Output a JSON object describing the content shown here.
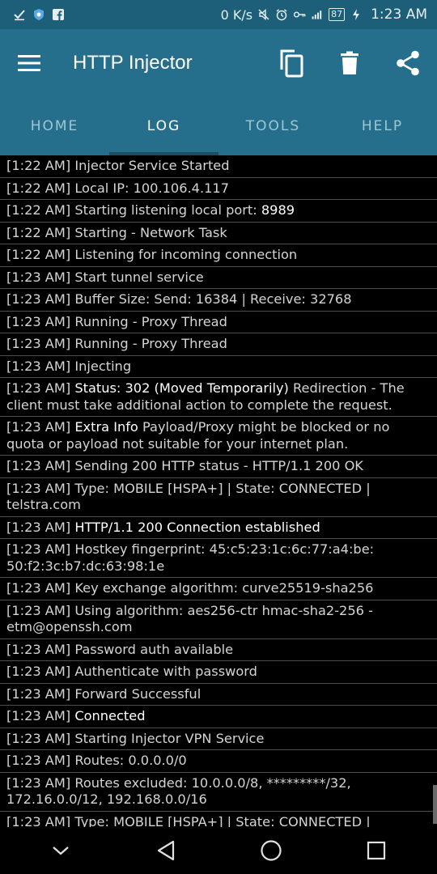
{
  "status_bar": {
    "speed": "0 K/s",
    "battery": "87",
    "time": "1:23 AM"
  },
  "app_bar": {
    "title": "HTTP Injector"
  },
  "tabs": [
    {
      "label": "HOME"
    },
    {
      "label": "LOG"
    },
    {
      "label": "TOOLS"
    },
    {
      "label": "HELP"
    }
  ],
  "log": [
    {
      "time": "[1:22 AM]",
      "text": "Injector Service Started"
    },
    {
      "time": "[1:22 AM]",
      "text": "Local IP: 100.106.4.117"
    },
    {
      "time": "[1:22 AM]",
      "text": "Starting listening local port: ",
      "hl": "8989"
    },
    {
      "time": "[1:22 AM]",
      "text": "Starting - Network Task"
    },
    {
      "time": "[1:22 AM]",
      "text": "Listening for incoming connection"
    },
    {
      "time": "[1:23 AM]",
      "text": "Start tunnel service"
    },
    {
      "time": "[1:23 AM]",
      "text": "Buffer Size: Send: 16384 | Receive: 32768"
    },
    {
      "time": "[1:23 AM]",
      "text": "Running - Proxy Thread"
    },
    {
      "time": "[1:23 AM]",
      "text": "Running - Proxy Thread"
    },
    {
      "time": "[1:23 AM]",
      "text": "Injecting"
    },
    {
      "time": "[1:23 AM]",
      "hl_first": "Status: 302 (Moved Temporarily)",
      "text": " Redirection - The client must take additional action to complete the request."
    },
    {
      "time": "[1:23 AM]",
      "hl_first": "Extra Info",
      "text": " Payload/Proxy might be blocked or no quota or payload not suitable for your internet plan."
    },
    {
      "time": "[1:23 AM]",
      "text": "Sending 200 HTTP status - HTTP/1.1 200 OK"
    },
    {
      "time": "[1:23 AM]",
      "text": "Type: MOBILE [HSPA+] | State: CONNECTED | telstra.com"
    },
    {
      "time": "[1:23 AM]",
      "hl_first": "HTTP/1.1 200 Connection established",
      "text": ""
    },
    {
      "time": "[1:23 AM]",
      "text": "Hostkey fingerprint: 45:c5:23:1c:6c:77:a4:be: 50:f2:3c:b7:dc:63:98:1e"
    },
    {
      "time": "[1:23 AM]",
      "text": "Key exchange algorithm: curve25519-sha256"
    },
    {
      "time": "[1:23 AM]",
      "text": "Using algorithm: aes256-ctr hmac-sha2-256 -etm@openssh.com"
    },
    {
      "time": "[1:23 AM]",
      "text": "Password auth available"
    },
    {
      "time": "[1:23 AM]",
      "text": "Authenticate with password"
    },
    {
      "time": "[1:23 AM]",
      "text": "Forward Successful"
    },
    {
      "time": "[1:23 AM]",
      "hl_first": "Connected",
      "text": ""
    },
    {
      "time": "[1:23 AM]",
      "text": "Starting Injector VPN Service"
    },
    {
      "time": "[1:23 AM]",
      "text": "Routes: 0.0.0.0/0"
    },
    {
      "time": "[1:23 AM]",
      "text": "Routes excluded: 10.0.0.0/8, *********/32, 172.16.0.0/12, 192.168.0.0/16"
    },
    {
      "time": "[1:23 AM]",
      "text": "Type: MOBILE [HSPA+] | State: CONNECTED | telstra.com"
    }
  ],
  "icons": {
    "menu": "hamburger-icon",
    "copy": "copy-icon",
    "delete": "trash-icon",
    "share": "share-icon",
    "nav_down": "chevron-down-icon",
    "nav_back": "back-triangle-icon",
    "nav_home": "home-circle-icon",
    "nav_recent": "recent-square-icon"
  },
  "colors": {
    "status_bar": "#1d5f79",
    "app_bar": "#256f8c",
    "tab_indicator": "#1c4f63",
    "log_bg": "#000000"
  }
}
